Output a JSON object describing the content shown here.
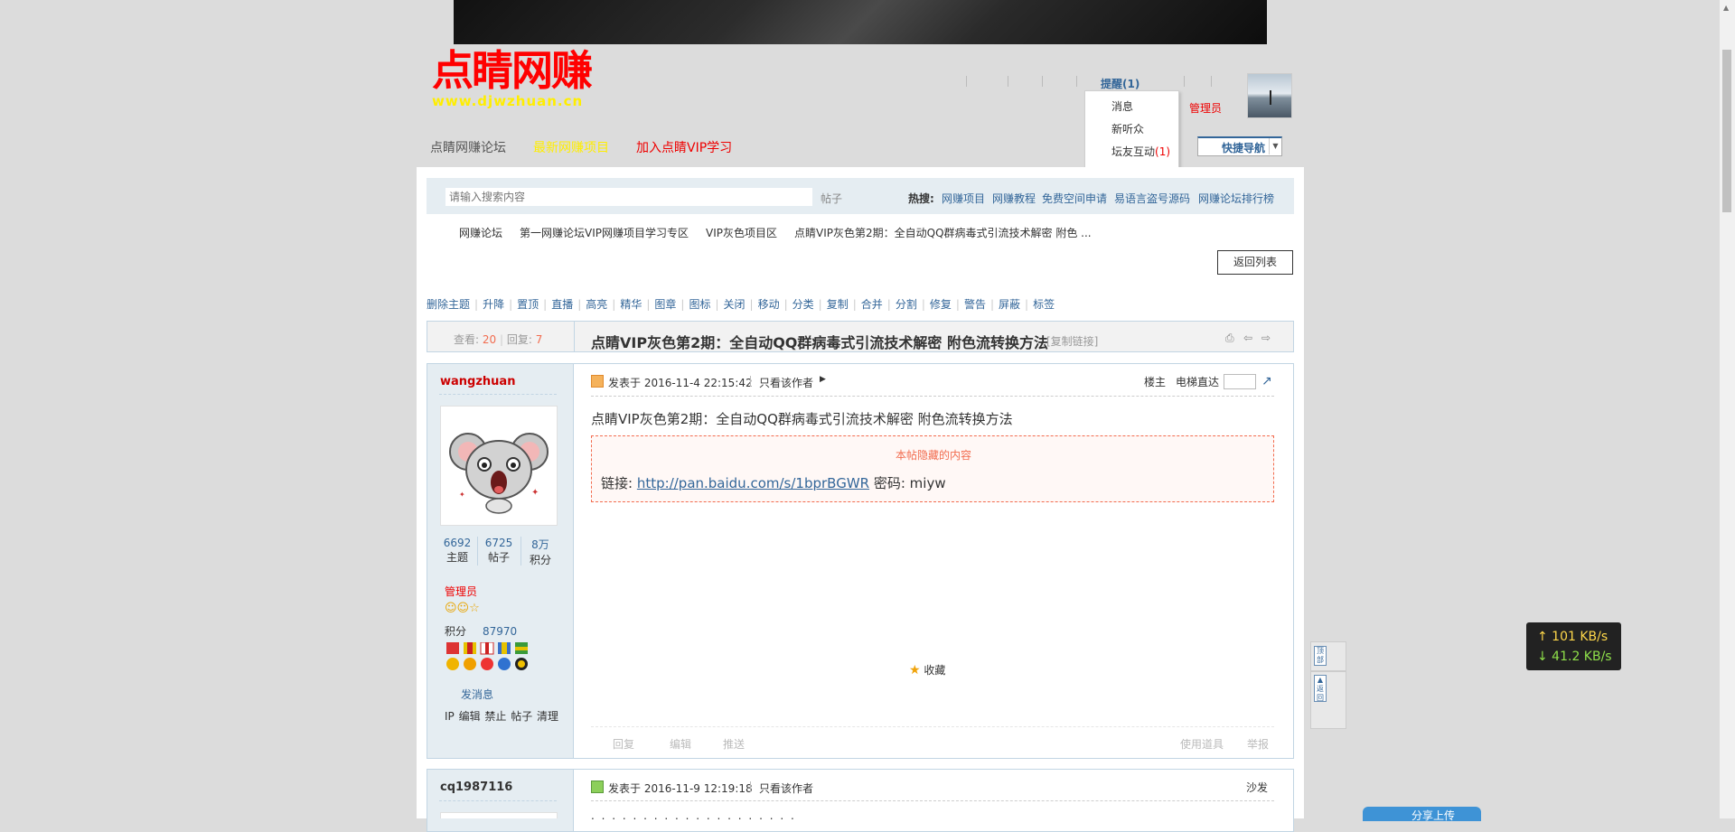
{
  "header": {
    "logo_main": "点睛网赚",
    "logo_url": "www.djwzhuan.cn",
    "reminder": "提醒(1)",
    "admin_link": "管理员",
    "dropdown": {
      "msg": "消息",
      "fans": "新听众",
      "interact_label": "坛友互动",
      "interact_count": "(1)"
    },
    "quicknav": "快捷导航"
  },
  "nav": {
    "forum": "点睛网赚论坛",
    "projects": "最新网赚项目",
    "vip": "加入点睛VIP学习"
  },
  "search": {
    "placeholder": "请输入搜索内容",
    "type": "帖子",
    "hot_label": "热搜:",
    "hot_links": [
      "网赚项目",
      "网赚教程",
      "免费空间申请",
      "易语言盗号源码",
      "网赚论坛排行榜"
    ]
  },
  "breadcrumb": [
    "网赚论坛",
    "第一网赚论坛VIP网赚项目学习专区",
    "VIP灰色项目区",
    "点睛VIP灰色第2期：全自动QQ群病毒式引流技术解密 附色 ..."
  ],
  "return_btn": "返回列表",
  "modbar": [
    "删除主题",
    "升降",
    "置顶",
    "直播",
    "高亮",
    "精华",
    "图章",
    "图标",
    "关闭",
    "移动",
    "分类",
    "复制",
    "合并",
    "分割",
    "修复",
    "警告",
    "屏蔽",
    "标签"
  ],
  "thread": {
    "views_label": "查看:",
    "views": "20",
    "replies_label": "回复:",
    "replies": "7",
    "title": "点睛VIP灰色第2期：全自动QQ群病毒式引流技术解密 附色流转换方法",
    "copylink": "[复制链接]"
  },
  "post1": {
    "author": "wangzhuan",
    "stats": [
      {
        "value": "6692",
        "label": "主题"
      },
      {
        "value": "6725",
        "label": "帖子"
      },
      {
        "value": "8万",
        "label": "积分"
      }
    ],
    "group": "管理员",
    "credit_label": "积分",
    "credit_value": "87970",
    "send_msg": "发消息",
    "admin_ops": "IP 编辑 禁止 帖子 清理",
    "posted": "发表于 2016-11-4 22:15:42",
    "only_author": "只看该作者",
    "floor": "楼主",
    "jump_label": "电梯直达",
    "title": "点睛VIP灰色第2期：全自动QQ群病毒式引流技术解密 附色流转换方法",
    "hidden_title": "本帖隐藏的内容",
    "link_label": "链接:",
    "link": "http://pan.baidu.com/s/1bprBGWR",
    "pwd": "密码: miyw",
    "fav": "收藏",
    "actions": [
      "回复",
      "编辑",
      "推送"
    ],
    "actions_right": [
      "使用道具",
      "举报"
    ]
  },
  "post2": {
    "author": "cq1987116",
    "posted": "发表于 2016-11-9 12:19:18",
    "only_author": "只看该作者",
    "floor": "沙发",
    "content": ". . . . . . . . . . . . . . . . . . . ."
  },
  "sidetools": {
    "top_label": "顶部",
    "back_label": "返回"
  },
  "speed": {
    "up": "↑ 101 KB/s",
    "down": "↓ 41.2 KB/s"
  },
  "share": "分享上传"
}
